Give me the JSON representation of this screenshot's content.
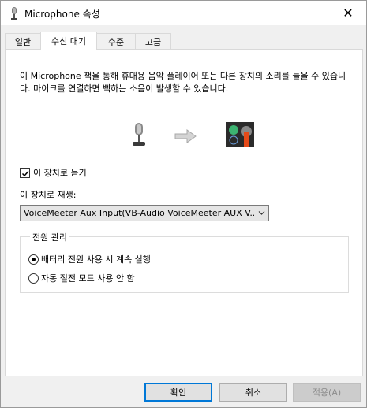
{
  "window": {
    "title": "Microphone 속성",
    "close_glyph": "✕"
  },
  "tabs": [
    {
      "label": "일반"
    },
    {
      "label": "수신 대기"
    },
    {
      "label": "수준"
    },
    {
      "label": "고급"
    }
  ],
  "listen": {
    "description": "이 Microphone 잭을 통해 휴대용 음악 플레이어 또는 다른 장치의 소리를 들을 수 있습니다. 마이크를 연결하면 삑하는 소음이 발생할 수 있습니다.",
    "listen_checkbox_label": "이 장치로 듣기",
    "listen_checked": true,
    "playback_label": "이 장치로 재생:",
    "playback_device": "VoiceMeeter Aux Input(VB-Audio VoiceMeeter AUX V...",
    "power": {
      "title": "전원 관리",
      "options": [
        {
          "label": "배터리 전원 사용 시 계속 실행",
          "selected": true
        },
        {
          "label": "자동 절전 모드 사용 안 함",
          "selected": false
        }
      ]
    }
  },
  "buttons": {
    "ok": "확인",
    "cancel": "취소",
    "apply": "적용(A)"
  },
  "colors": {
    "accent": "#0078d7",
    "device_icon_bg": "#2b2b2b",
    "device_icon_red": "#e64a19",
    "device_icon_green": "#3cb371"
  }
}
